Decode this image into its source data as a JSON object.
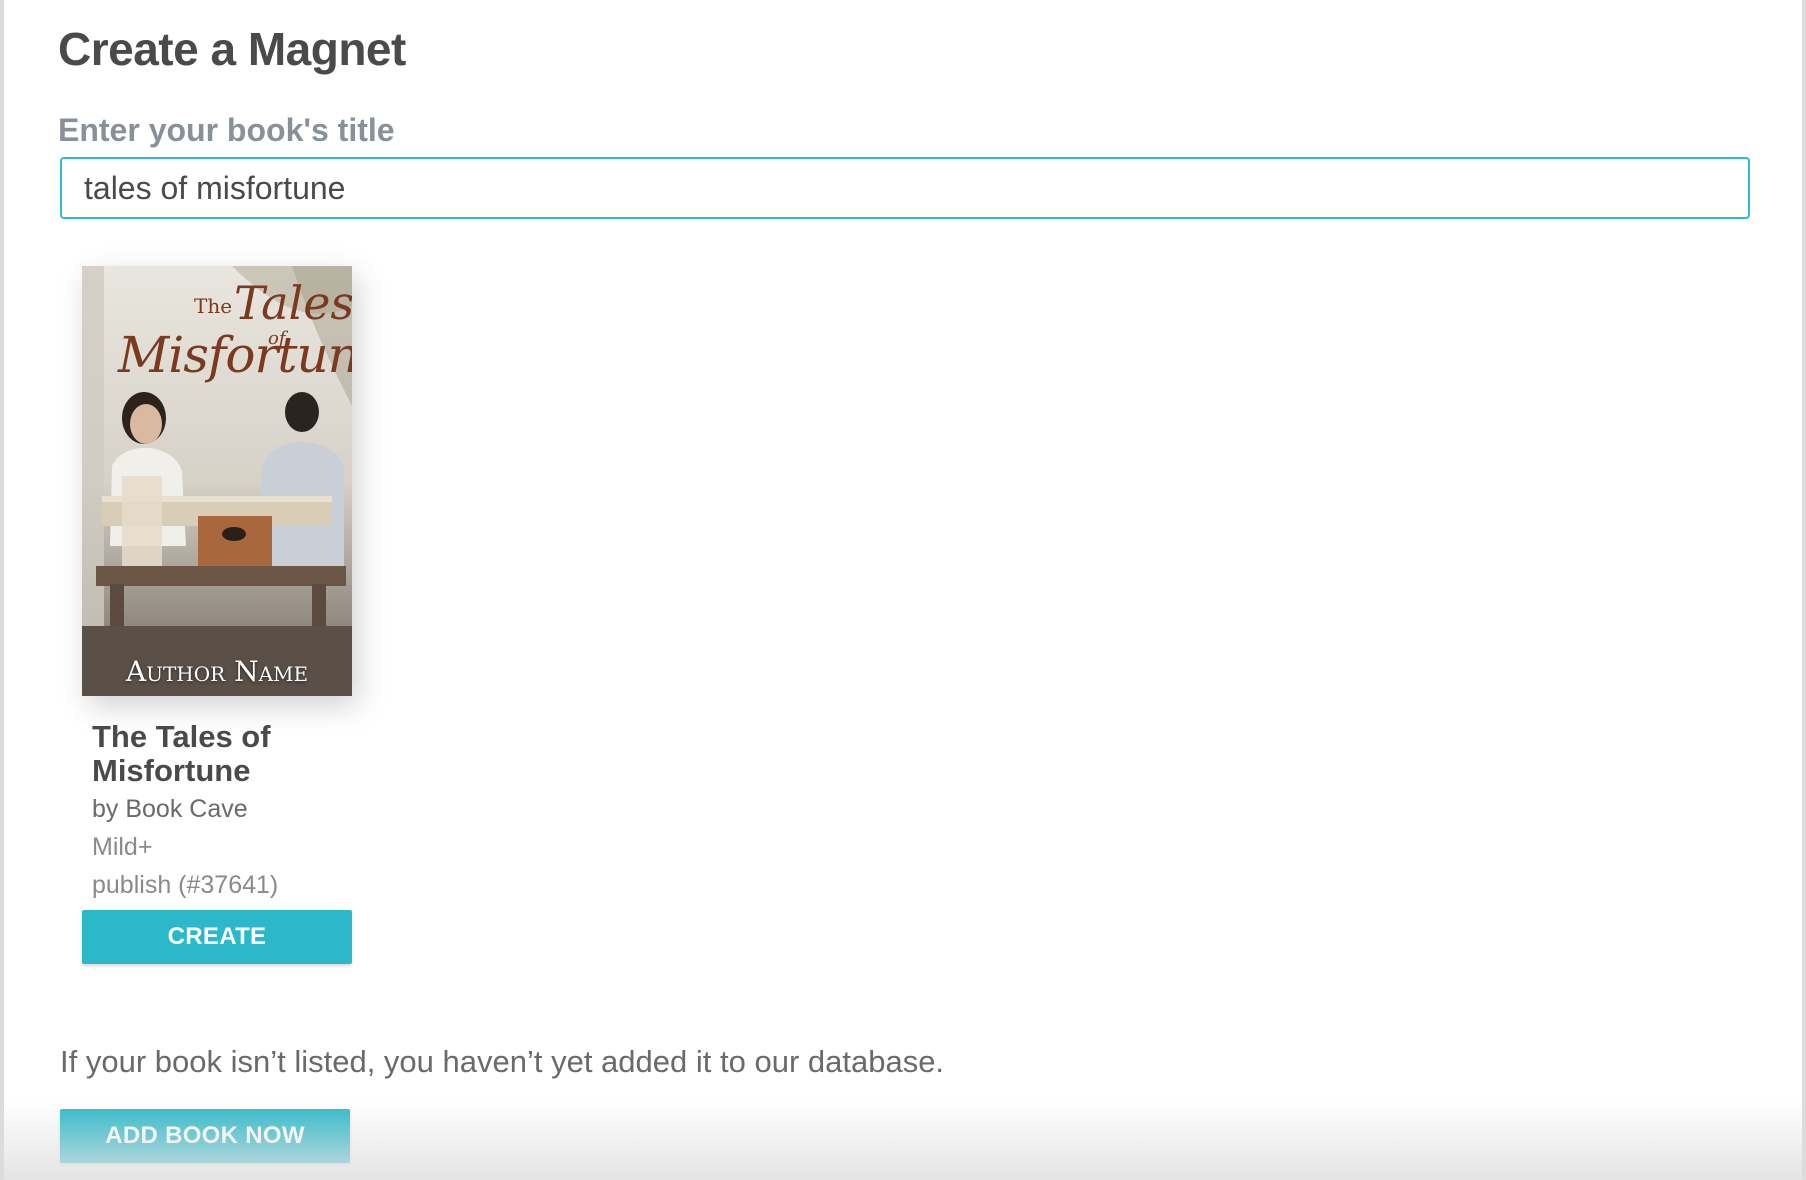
{
  "page": {
    "title": "Create a Magnet"
  },
  "search": {
    "label": "Enter your book's title",
    "value": "tales of misfortune"
  },
  "results": [
    {
      "cover": {
        "title_small": "The",
        "title_main": "Tales",
        "title_of": "of",
        "title_word": "Misfortune",
        "author": "Author Name"
      },
      "title": "The Tales of Misfortune",
      "author": "by Book Cave",
      "rating": "Mild+",
      "status": "publish (#37641)",
      "create_label": "CREATE"
    }
  ],
  "footer": {
    "note": "If your book isn’t listed, you haven’t yet added it to our database.",
    "add_label": "ADD BOOK NOW"
  },
  "colors": {
    "accent": "#2bb9c9",
    "input_border": "#2cbccb",
    "text_dark": "#4a4a4a",
    "label_gray": "#8a9099"
  }
}
